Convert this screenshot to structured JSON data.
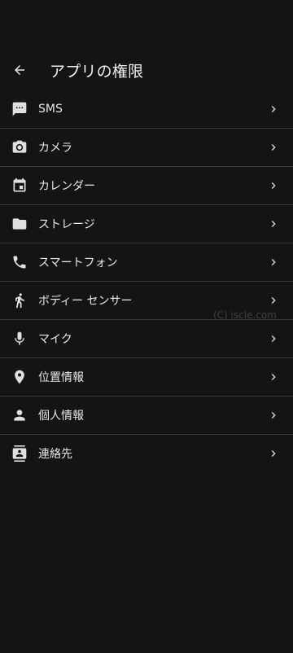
{
  "header": {
    "title": "アプリの権限",
    "back_icon": "arrow-back-icon"
  },
  "permissions": [
    {
      "label": "SMS",
      "icon": "sms-icon"
    },
    {
      "label": "カメラ",
      "icon": "camera-icon"
    },
    {
      "label": "カレンダー",
      "icon": "calendar-icon"
    },
    {
      "label": "ストレージ",
      "icon": "folder-icon"
    },
    {
      "label": "スマートフォン",
      "icon": "phone-icon"
    },
    {
      "label": "ボディー センサー",
      "icon": "walking-icon"
    },
    {
      "label": "マイク",
      "icon": "microphone-icon"
    },
    {
      "label": "位置情報",
      "icon": "location-pin-icon"
    },
    {
      "label": "個人情報",
      "icon": "person-icon"
    },
    {
      "label": "連絡先",
      "icon": "contacts-icon"
    }
  ],
  "watermark": "(C) iscle.com",
  "colors": {
    "background": "#131414",
    "text": "#e8e8e8",
    "divider": "#3a3b3b",
    "icon": "#e0e0e0"
  }
}
